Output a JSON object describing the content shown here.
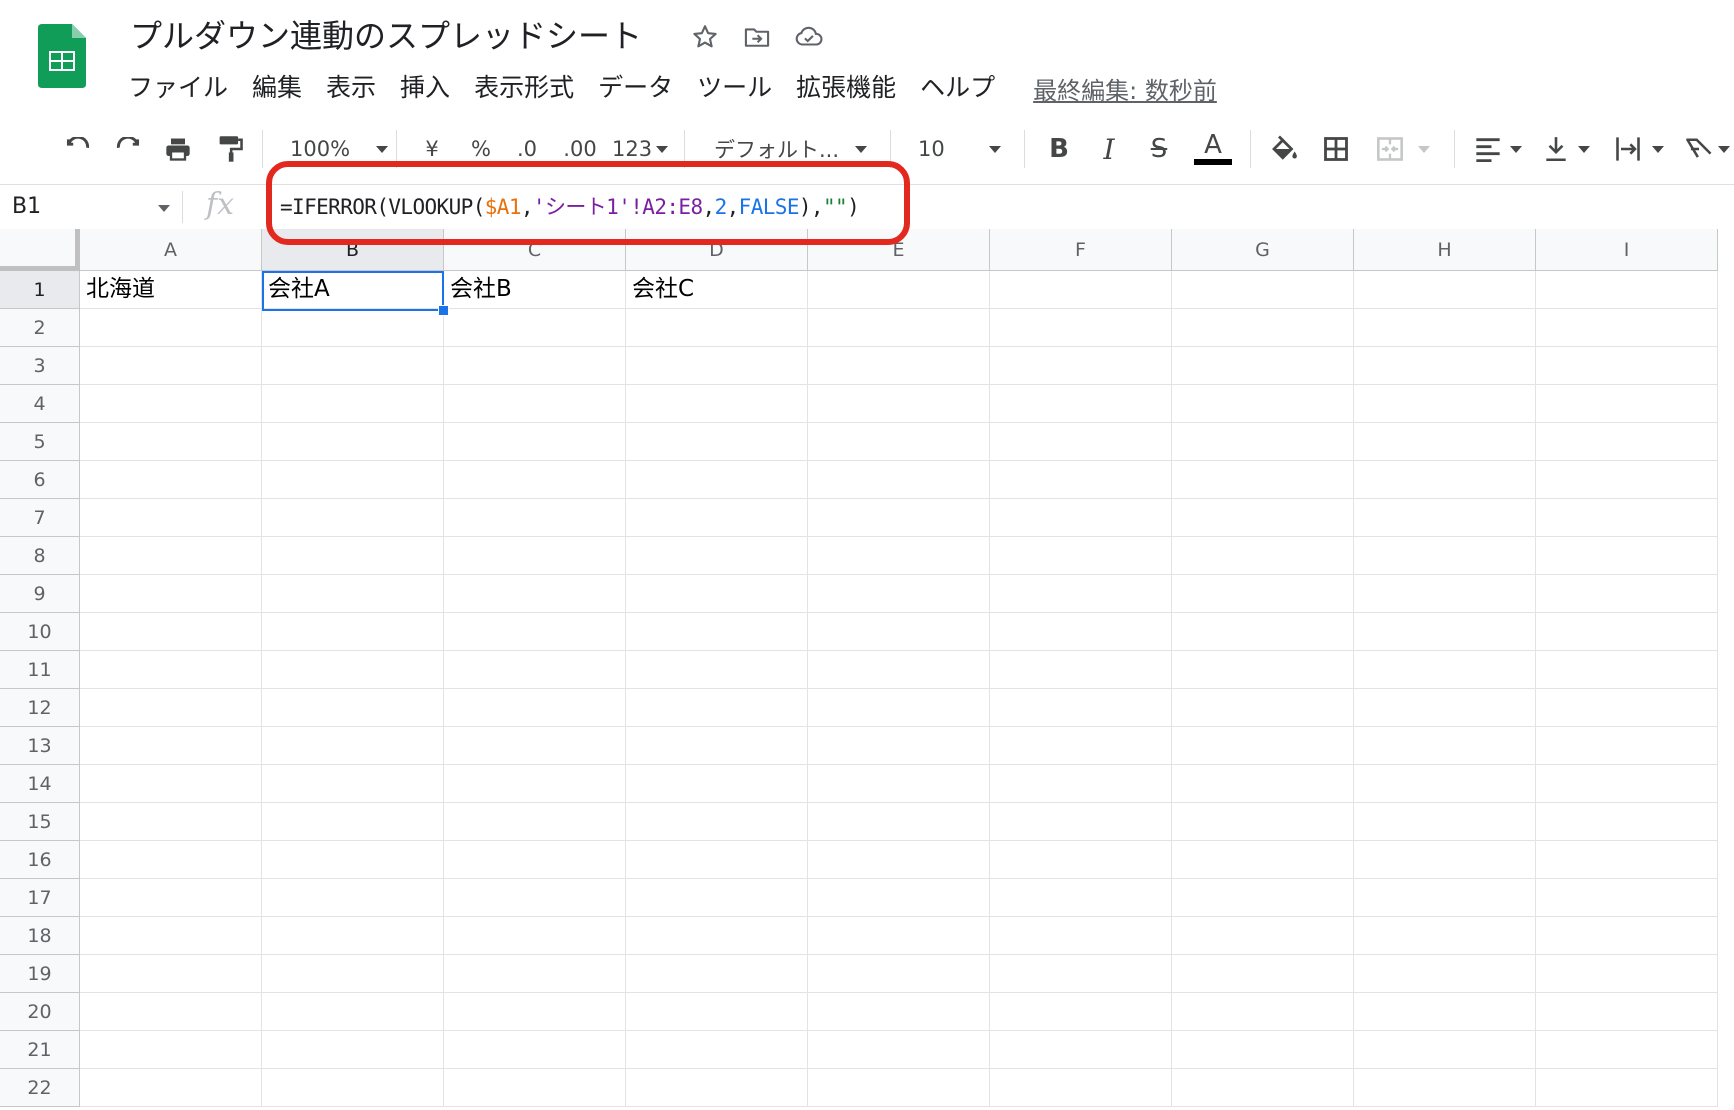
{
  "header": {
    "title": "プルダウン連動のスプレッドシート",
    "icons": [
      "star-icon",
      "move-to-folder-icon",
      "cloud-saved-icon"
    ],
    "menu": [
      "ファイル",
      "編集",
      "表示",
      "挿入",
      "表示形式",
      "データ",
      "ツール",
      "拡張機能",
      "ヘルプ"
    ],
    "last_edit": "最終編集: 数秒前"
  },
  "toolbar": {
    "zoom": "100%",
    "currency": "¥",
    "percent": "%",
    "decimal_decrease": ".0",
    "decimal_increase": ".00",
    "number_format": "123",
    "font": "デフォルト...",
    "font_size": "10",
    "bold": "B",
    "italic": "I",
    "strike": "S",
    "text_color_label": "A"
  },
  "formula_bar": {
    "name_box": "B1",
    "fx": "fx",
    "formula_parts": {
      "p1": "=IFERROR(VLOOKUP(",
      "p2": "$A1",
      "p3": ",",
      "p4": "'シート1'!A2:E8",
      "p5": ",",
      "p6": "2",
      "p7": ",",
      "p8": "FALSE",
      "p9": "),",
      "p10": "\"\"",
      "p11": ")"
    }
  },
  "colors": {
    "ref": "#e8710a",
    "range": "#7b1fa2",
    "number": "#1a73e8",
    "bool": "#1a73e8",
    "string": "#188038",
    "highlight": "#e3291f",
    "selection": "#1a73e8"
  },
  "grid": {
    "selected_cell": "B1",
    "columns": [
      "A",
      "B",
      "C",
      "D",
      "E",
      "F",
      "G",
      "H",
      "I"
    ],
    "rows": [
      "1",
      "2",
      "3",
      "4",
      "5",
      "6",
      "7",
      "8",
      "9",
      "10",
      "11",
      "12",
      "13",
      "14",
      "15",
      "16",
      "17",
      "18",
      "19",
      "20",
      "21",
      "22"
    ],
    "cells": {
      "A1": "北海道",
      "B1": "会社A",
      "C1": "会社B",
      "D1": "会社C"
    }
  }
}
